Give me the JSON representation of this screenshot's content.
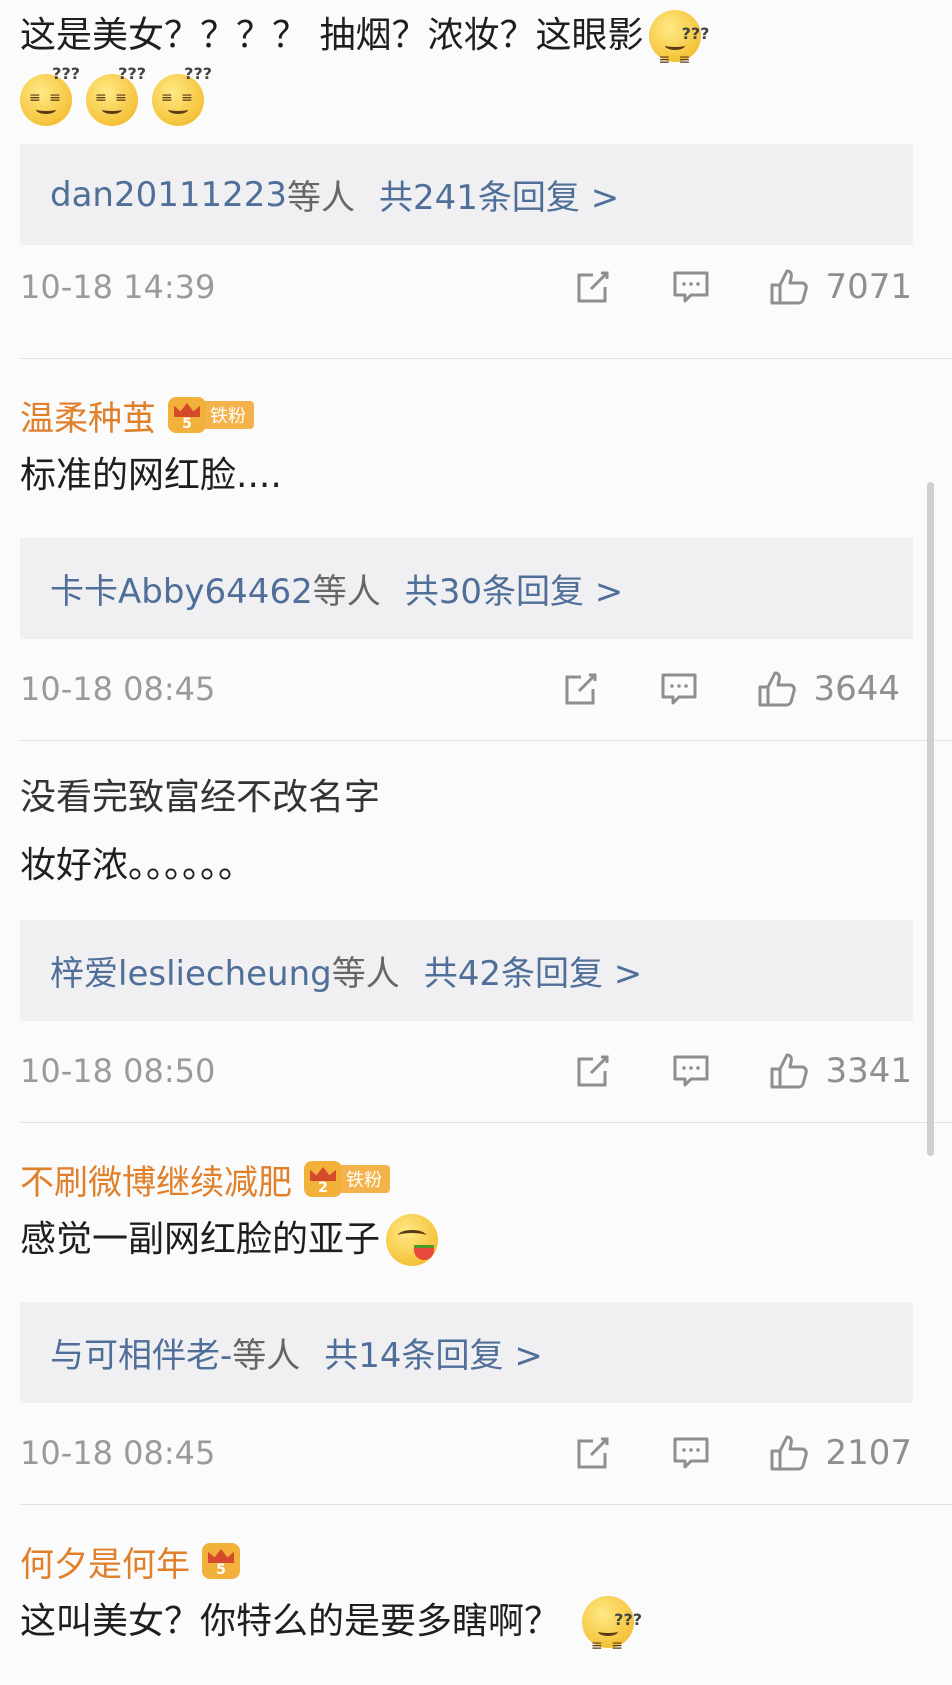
{
  "comments": [
    {
      "author": "",
      "text_lines": [
        "这是美女？？？？ 抽烟？浓妆？这眼影"
      ],
      "emoji_top": "dizzy-face-emoji",
      "emoji_row_count": 3,
      "reply_users": "dan20111223",
      "reply_suffix": "等人",
      "reply_count": "共241条回复 >",
      "time": "10-18 14:39",
      "likes": "7071"
    },
    {
      "author": "温柔种茧",
      "badge_level": "5",
      "badge_label": "铁粉",
      "text_lines": [
        "标准的网红脸...."
      ],
      "reply_users": "卡卡Abby64462",
      "reply_suffix": "等人",
      "reply_count": "共30条回复 >",
      "time": "10-18 08:45",
      "likes": "3644"
    },
    {
      "author": "",
      "text_lines": [
        "没看完致富经不改名字",
        "妆好浓。。。。。。"
      ],
      "reply_users": "梓爱lesliecheung",
      "reply_suffix": "等人",
      "reply_count": "共42条回复 >",
      "time": "10-18 08:50",
      "likes": "3341"
    },
    {
      "author": "不刷微博继续减肥",
      "badge_level": "2",
      "badge_label": "铁粉",
      "text_lines": [
        "感觉一副网红脸的亚子"
      ],
      "reply_users": "与可相伴老-",
      "reply_suffix": "等人",
      "reply_count": "共14条回复 >",
      "time": "10-18 08:45",
      "likes": "2107"
    },
    {
      "author": "何夕是何年",
      "badge_level": "5",
      "text_lines": [
        "这叫美女？你特么的是要多瞎啊？"
      ]
    }
  ],
  "icons": {
    "share": "share-icon",
    "comment": "comment-icon",
    "like": "thumbs-up-icon"
  },
  "colors": {
    "author": "#e0802b",
    "reply_link": "#4f6f99",
    "meta": "#9a9a9a",
    "reply_bg": "#f0f0f2"
  }
}
